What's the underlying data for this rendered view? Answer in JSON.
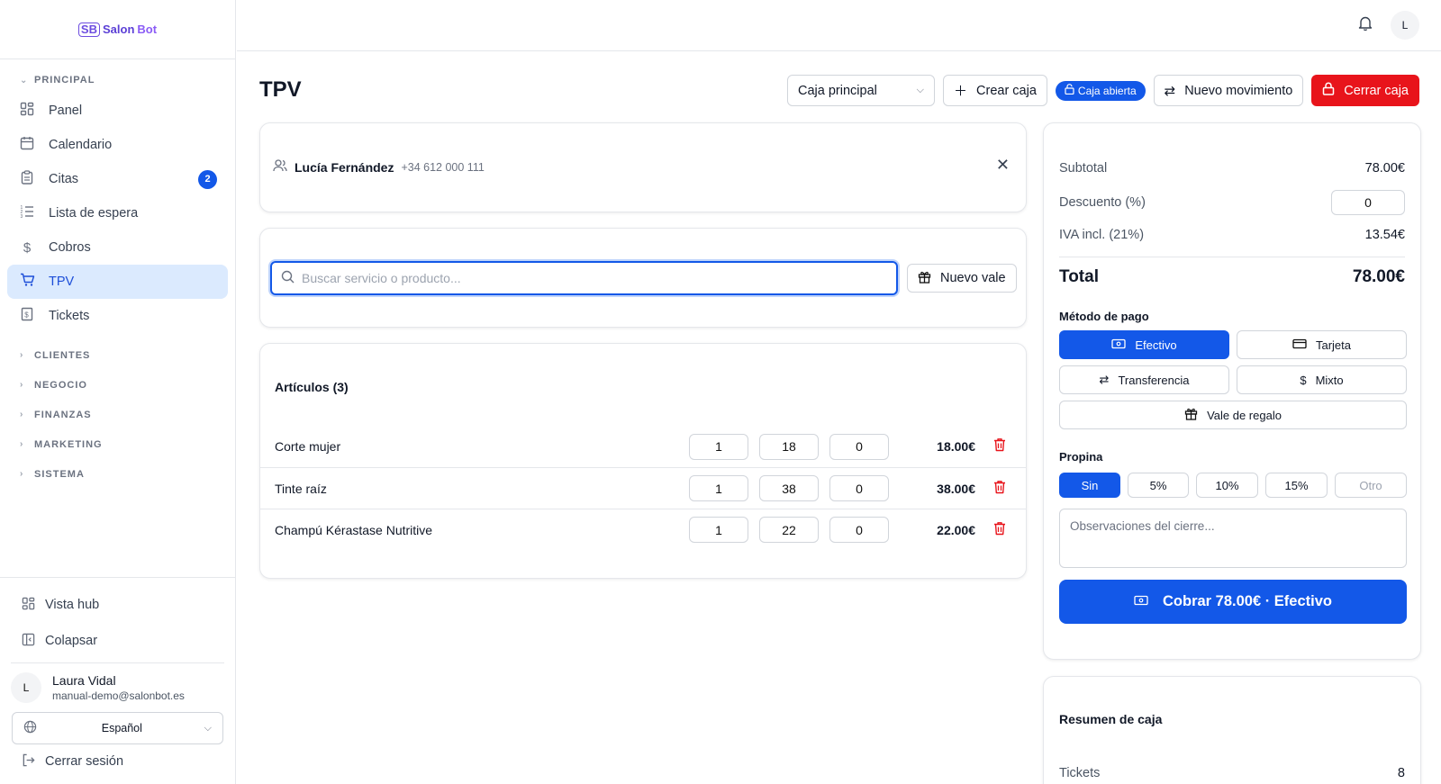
{
  "brand": {
    "name_part1": "Salon",
    "name_part2": "Bot",
    "icon": "sb-logo-icon"
  },
  "sidebar": {
    "section_principal": "PRINCIPAL",
    "items": [
      {
        "label": "Panel",
        "icon": "grid-icon"
      },
      {
        "label": "Calendario",
        "icon": "calendar-icon"
      },
      {
        "label": "Citas",
        "icon": "clipboard-icon",
        "badge": "2"
      },
      {
        "label": "Lista de espera",
        "icon": "list-icon"
      },
      {
        "label": "Cobros",
        "icon": "dollar-icon"
      },
      {
        "label": "TPV",
        "icon": "cart-icon",
        "active": true
      },
      {
        "label": "Tickets",
        "icon": "receipt-icon"
      }
    ],
    "sections": [
      "CLIENTES",
      "NEGOCIO",
      "FINANZAS",
      "MARKETING",
      "SISTEMA"
    ],
    "bottom": {
      "hub_label": "Vista hub",
      "collapse_label": "Colapsar",
      "user_initial": "L",
      "user_name": "Laura Vidal",
      "user_email": "manual-demo@salonbot.es",
      "language": "Español",
      "logout_label": "Cerrar sesión"
    }
  },
  "topbar": {
    "avatar_initial": "L"
  },
  "header": {
    "title": "TPV",
    "caja_select": "Caja principal",
    "create_caja": "Crear caja",
    "status": "Caja abierta",
    "new_movement": "Nuevo movimiento",
    "close_caja": "Cerrar caja"
  },
  "client": {
    "name": "Lucía Fernández",
    "phone": "+34 612 000 111"
  },
  "search": {
    "placeholder": "Buscar servicio o producto...",
    "voucher_button": "Nuevo vale"
  },
  "items": {
    "title": "Artículos (3)",
    "rows": [
      {
        "name": "Corte mujer",
        "qty": "1",
        "price": "18",
        "discount": "0",
        "total": "18.00€"
      },
      {
        "name": "Tinte raíz",
        "qty": "1",
        "price": "38",
        "discount": "0",
        "total": "38.00€"
      },
      {
        "name": "Champú Kérastase Nutritive",
        "qty": "1",
        "price": "22",
        "discount": "0",
        "total": "22.00€"
      }
    ]
  },
  "payment": {
    "subtotal_label": "Subtotal",
    "subtotal_value": "78.00€",
    "discount_label": "Descuento (%)",
    "discount_value": "0",
    "iva_label": "IVA incl. (21%)",
    "iva_value": "13.54€",
    "total_label": "Total",
    "total_value": "78.00€",
    "method_label": "Método de pago",
    "methods": [
      "Efectivo",
      "Tarjeta",
      "Transferencia",
      "Mixto",
      "Vale de regalo"
    ],
    "tip_label": "Propina",
    "tips": [
      "Sin",
      "5%",
      "10%",
      "15%"
    ],
    "tip_other_placeholder": "Otro",
    "notes_placeholder": "Observaciones del cierre...",
    "charge_button": "Cobrar 78.00€ · Efectivo"
  },
  "summary": {
    "title": "Resumen de caja",
    "tickets_label": "Tickets",
    "tickets_value": "8"
  },
  "colors": {
    "primary": "#1358e8",
    "danger": "#e8141b",
    "active_bg": "#dbeafe",
    "brand": "#5b3fd6"
  }
}
